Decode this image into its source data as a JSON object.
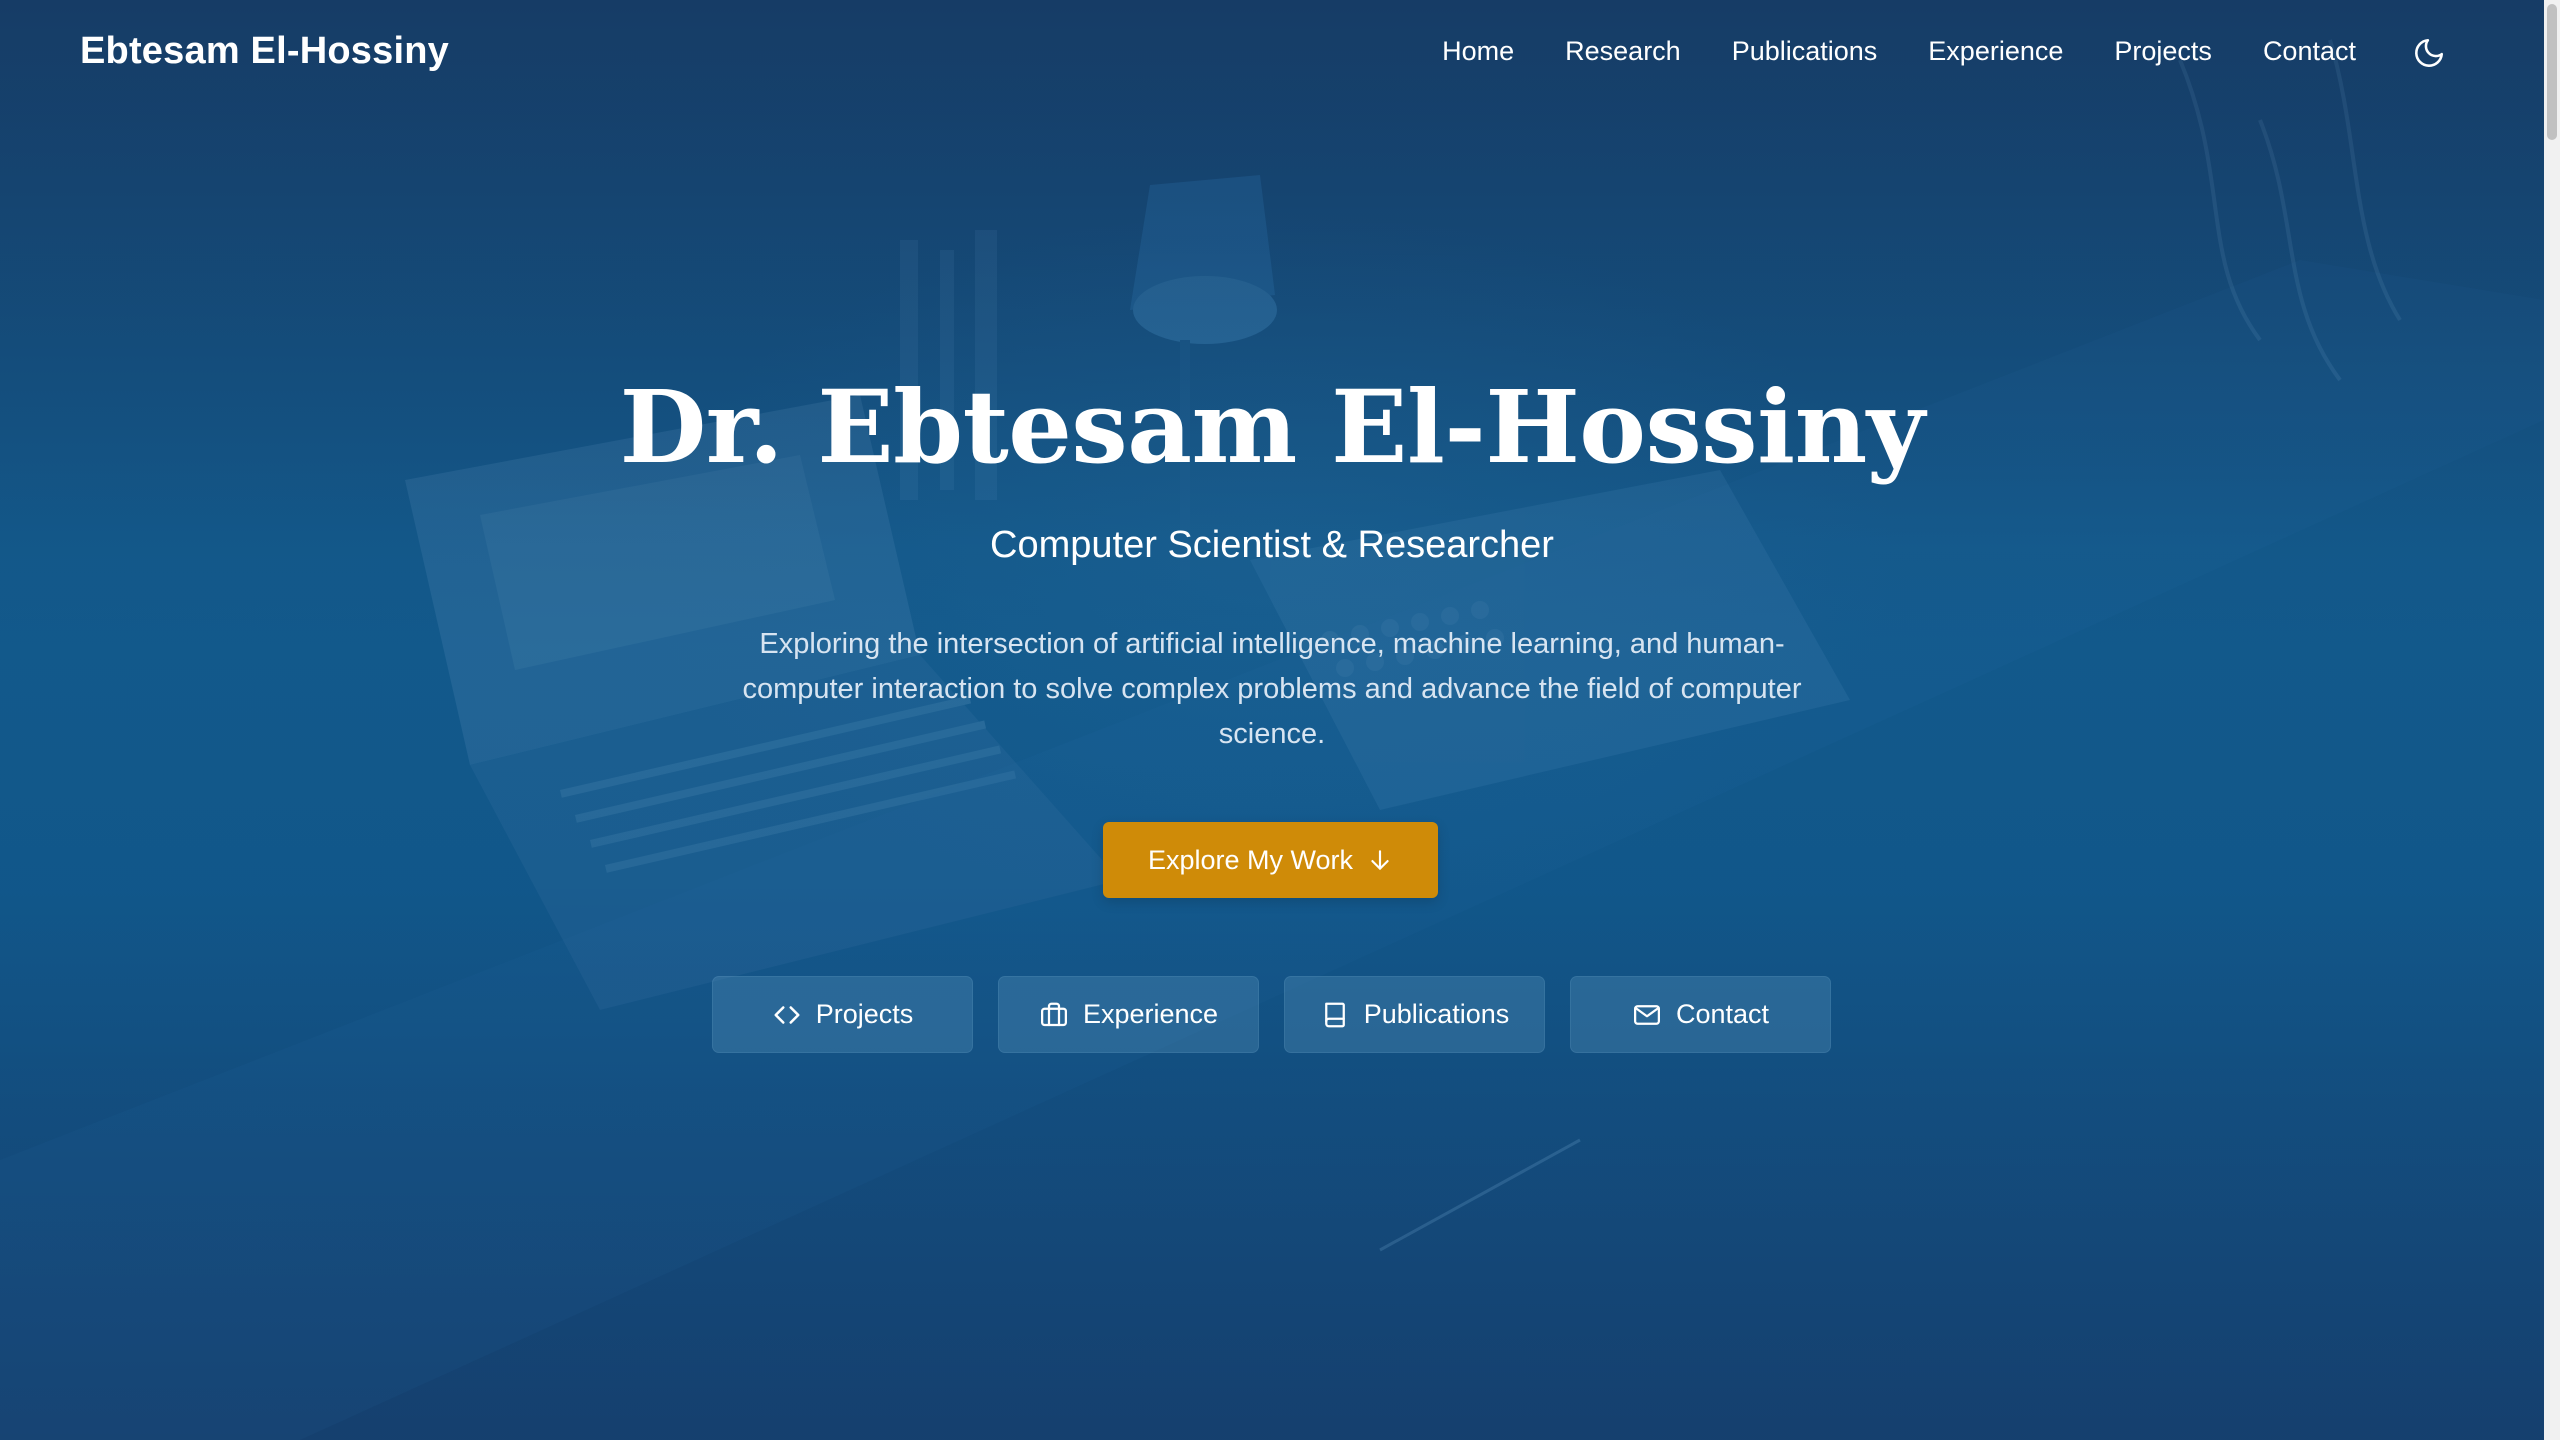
{
  "nav": {
    "brand": "Ebtesam El-Hossiny",
    "links": [
      "Home",
      "Research",
      "Publications",
      "Experience",
      "Projects",
      "Contact"
    ],
    "theme_toggle_icon": "moon-icon"
  },
  "hero": {
    "title": "Dr. Ebtesam El-Hossiny",
    "subtitle": "Computer Scientist & Researcher",
    "description": "Exploring the intersection of artificial intelligence, machine learning, and human-computer interaction to solve complex problems and advance the field of computer science.",
    "cta": {
      "label": "Explore My Work",
      "icon": "arrow-down-icon",
      "color": "#cf8b08"
    },
    "quick_links": [
      {
        "label": "Projects",
        "icon": "code-icon"
      },
      {
        "label": "Experience",
        "icon": "briefcase-icon"
      },
      {
        "label": "Publications",
        "icon": "book-icon"
      },
      {
        "label": "Contact",
        "icon": "mail-icon"
      }
    ]
  },
  "colors": {
    "background_top": "#173f6a",
    "background_mid": "#135a8c",
    "accent": "#cf8b08",
    "text": "#ffffff"
  }
}
